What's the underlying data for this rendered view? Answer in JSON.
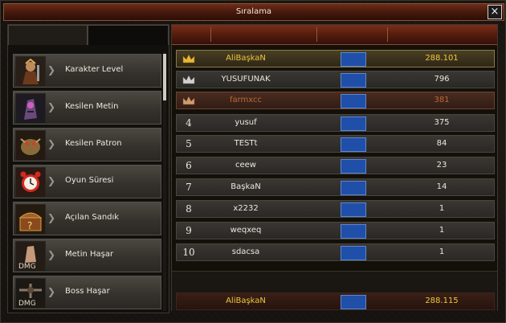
{
  "window": {
    "title": "Sıralama",
    "close_glyph": "×"
  },
  "sidebar": {
    "items": [
      {
        "label": "Karakter Level",
        "icon": "warrior-portrait-icon"
      },
      {
        "label": "Kesilen Metin",
        "icon": "metin-stone-icon"
      },
      {
        "label": "Kesilen Patron",
        "icon": "boss-monster-icon"
      },
      {
        "label": "Oyun Süresi",
        "icon": "alarm-clock-icon"
      },
      {
        "label": "Açılan Sandık",
        "icon": "treasure-chest-icon"
      },
      {
        "label": "Metin Haşar",
        "icon": "metin-damage-icon"
      },
      {
        "label": "Boss Haşar",
        "icon": "boss-damage-icon"
      }
    ],
    "dmg_label": "DMG"
  },
  "ranking": {
    "rows": [
      {
        "rank": "",
        "crown": "gold-crown-icon",
        "name": "AliBaşkaN",
        "value": "288.101",
        "style": "gold"
      },
      {
        "rank": "",
        "crown": "silver-crown-icon",
        "name": "YUSUFUNAK",
        "value": "796",
        "style": "white"
      },
      {
        "rank": "",
        "crown": "bronze-crown-icon",
        "name": "farmxcc",
        "value": "381",
        "style": "brown"
      },
      {
        "rank": "4",
        "name": "yusuf",
        "value": "375",
        "style": "white"
      },
      {
        "rank": "5",
        "name": "TESTt",
        "value": "84",
        "style": "white"
      },
      {
        "rank": "6",
        "name": "ceew",
        "value": "23",
        "style": "white"
      },
      {
        "rank": "7",
        "name": "BaşkaN",
        "value": "14",
        "style": "white"
      },
      {
        "rank": "8",
        "name": "x2232",
        "value": "1",
        "style": "white"
      },
      {
        "rank": "9",
        "name": "weqxeq",
        "value": "1",
        "style": "white"
      },
      {
        "rank": "10",
        "name": "sdacsa",
        "value": "1",
        "style": "white"
      }
    ],
    "self": {
      "name": "AliBaşkaN",
      "value": "288.115"
    }
  },
  "colors": {
    "gold": "#f0c73a",
    "brown": "#b86a3a",
    "header": "#6e2c18",
    "flag": "#1f4fa8"
  }
}
